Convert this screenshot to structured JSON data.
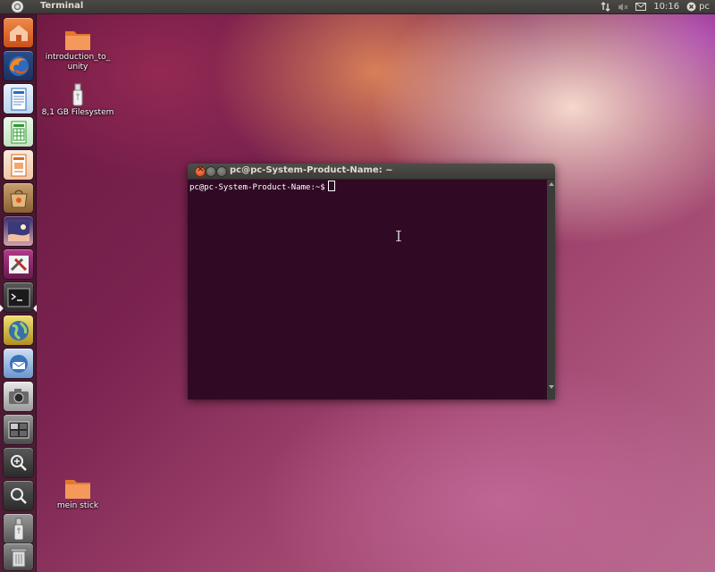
{
  "top_panel": {
    "app_title": "Terminal",
    "clock": "10:16",
    "user": "pc"
  },
  "launcher": {
    "items": [
      {
        "name": "home-folder",
        "icon": "home-folder-icon",
        "color": "#e06a2a"
      },
      {
        "name": "firefox",
        "icon": "firefox-icon",
        "color": "#e87a1c"
      },
      {
        "name": "libreoffice-writer",
        "icon": "writer-icon",
        "color": "#2a6cbf"
      },
      {
        "name": "libreoffice-calc",
        "icon": "calc-icon",
        "color": "#2f9a2f"
      },
      {
        "name": "libreoffice-impress",
        "icon": "impress-icon",
        "color": "#d8691f"
      },
      {
        "name": "software-center",
        "icon": "software-center-icon",
        "color": "#b5814b"
      },
      {
        "name": "ubuntu-one",
        "icon": "night-scene-icon",
        "color": "#5a3a7a"
      },
      {
        "name": "system-settings",
        "icon": "tools-icon",
        "color": "#8a2a6a"
      },
      {
        "name": "terminal",
        "icon": "terminal-icon",
        "color": "#2c2c2c"
      },
      {
        "name": "empathy",
        "icon": "globe-icon",
        "color": "#3a6ea8"
      },
      {
        "name": "thunderbird",
        "icon": "mail-bird-icon",
        "color": "#3a72b8"
      },
      {
        "name": "camera",
        "icon": "camera-icon",
        "color": "#9a9a9a"
      },
      {
        "name": "workspace-switcher",
        "icon": "workspace-icon",
        "color": "#6a6a6a"
      },
      {
        "name": "zoom-in",
        "icon": "zoom-in-icon",
        "color": "#4a4a4a"
      },
      {
        "name": "zoom-search",
        "icon": "search-icon",
        "color": "#4a4a4a"
      },
      {
        "name": "usb-drive",
        "icon": "usb-drive-icon",
        "color": "#7a7a7a"
      },
      {
        "name": "trash",
        "icon": "trash-icon",
        "color": "#7a7a7a"
      }
    ]
  },
  "desktop": {
    "icons": [
      {
        "label": "introduction_to_ unity",
        "icon": "folder-icon"
      },
      {
        "label": "8,1 GB Filesystem",
        "icon": "usb-drive-icon"
      },
      {
        "label": "mein stick",
        "icon": "folder-icon"
      }
    ]
  },
  "terminal": {
    "title": "pc@pc-System-Product-Name: ~",
    "prompt": "pc@pc-System-Product-Name:~$",
    "background": "#300a24"
  }
}
